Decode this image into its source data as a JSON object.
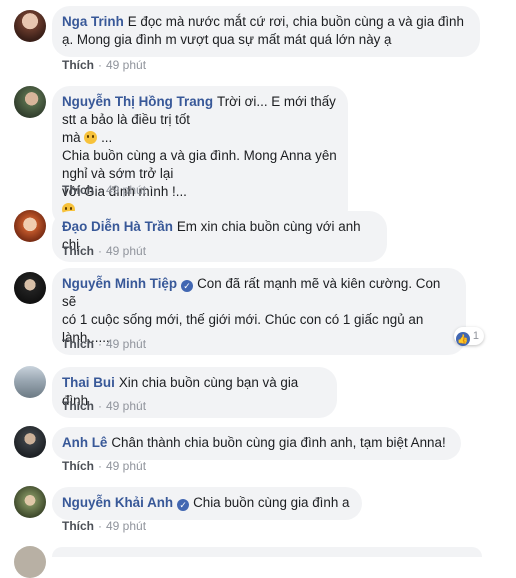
{
  "meta": {
    "like_label": "Thích",
    "separator": "·",
    "time": "49 phút"
  },
  "comments": [
    {
      "author": "Nga Trinh",
      "text_lines": [
        "E đọc mà nước mắt cứ rơi, chia buồn cùng a và gia đình",
        "ạ. Mong gia đình m vượt qua sự mất mát quá lớn này ạ"
      ]
    },
    {
      "author": "Nguyễn Thị Hồng Trang",
      "line1": "Trời ơi... E mới thấy stt a bảo là điều trị tốt",
      "line2": "mà",
      "line2_tail": "...",
      "line3": "Chia buồn cùng a và gia đình. Mong Anna yên nghỉ và sớm trở lại",
      "line4": "với Gia đình mình !..."
    },
    {
      "author": "Đạo Diễn Hà Trần",
      "text": "Em xin chia buồn cùng với anh chị"
    },
    {
      "author": "Nguyễn Minh Tiệp",
      "verified": true,
      "text_lines": [
        "Con đã rất mạnh mẽ và kiên cường. Con sẽ",
        "có 1 cuộc sống mới, thế giới mới. Chúc con có 1 giấc ngủ an",
        "lành......"
      ],
      "reaction_count": "1"
    },
    {
      "author": "Thai Bui",
      "text": "Xin chia buồn cùng bạn và gia đình"
    },
    {
      "author": "Anh Lê",
      "text": "Chân thành chia buồn cùng gia đình anh, tạm biệt Anna!"
    },
    {
      "author": "Nguyễn Khải Anh",
      "verified": true,
      "text": "Chia buồn cùng gia đình a"
    }
  ],
  "colors": {
    "link": "#385898",
    "bubble": "#f2f3f5",
    "meta": "#90949c",
    "verified": "#4267b2"
  },
  "icons": [
    "sad-emoji",
    "verified-badge",
    "like-reaction-icon"
  ]
}
